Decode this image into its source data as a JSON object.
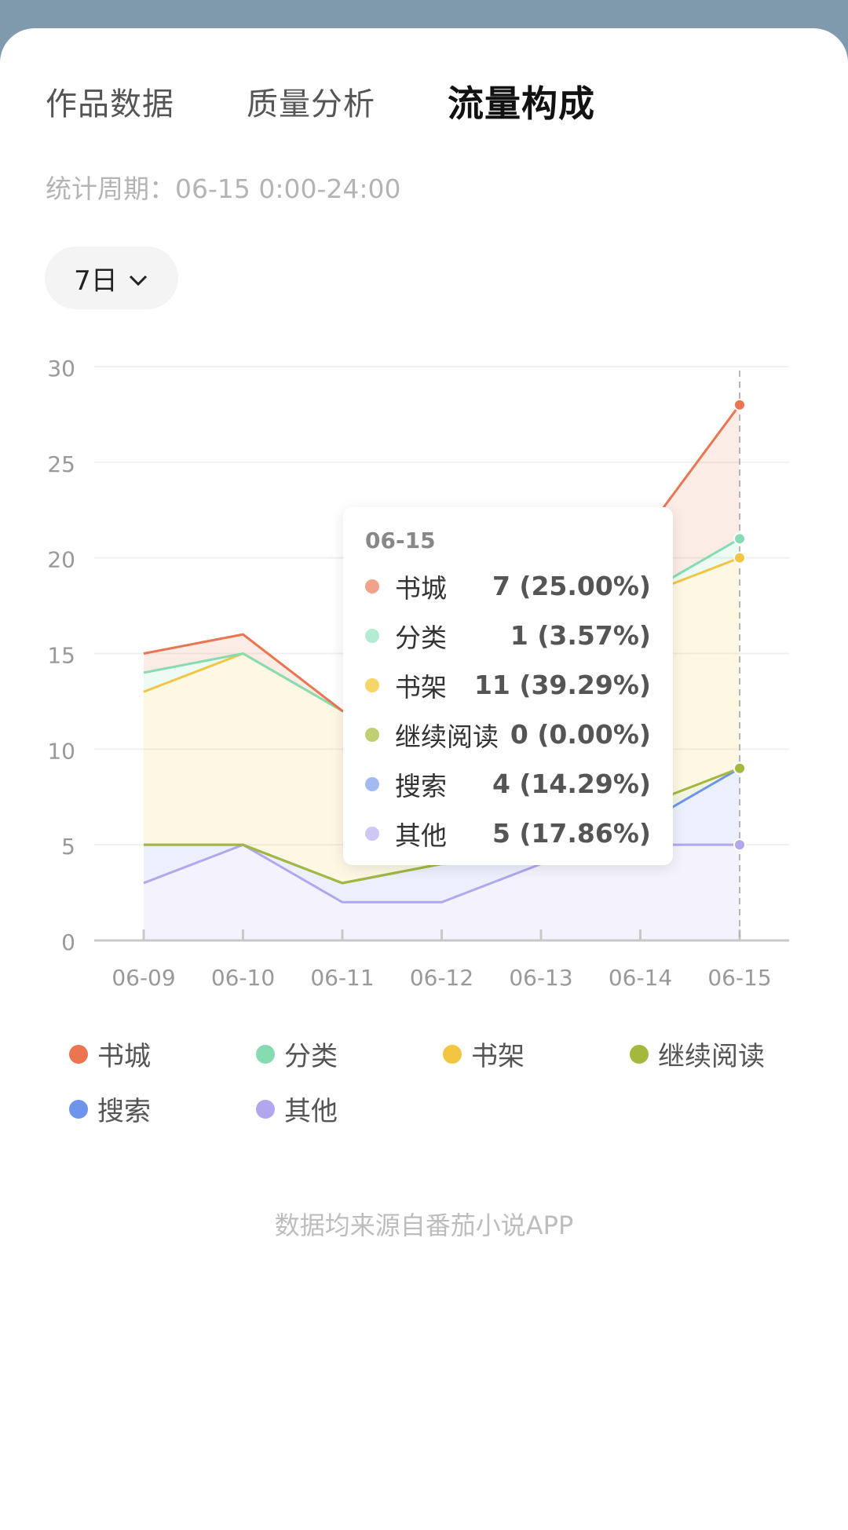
{
  "tabs": [
    {
      "label": "作品数据",
      "active": false
    },
    {
      "label": "质量分析",
      "active": false
    },
    {
      "label": "流量构成",
      "active": true
    }
  ],
  "period_text": "统计周期：06-15 0:00-24:00",
  "range_selector": {
    "label": "7日",
    "icon": "chevron-down-icon"
  },
  "chart_data": {
    "type": "area",
    "stacked": true,
    "categories": [
      "06-09",
      "06-10",
      "06-11",
      "06-12",
      "06-13",
      "06-14",
      "06-15"
    ],
    "ylim": [
      0,
      30
    ],
    "yticks": [
      0,
      5,
      10,
      15,
      20,
      25,
      30
    ],
    "grid": true,
    "series": [
      {
        "name": "其他",
        "color": "#b1a7ef",
        "values": [
          3,
          5,
          2,
          2,
          4,
          5,
          5
        ]
      },
      {
        "name": "搜索",
        "color": "#6f94ec",
        "values": [
          2,
          0,
          1,
          2,
          1,
          1,
          4
        ]
      },
      {
        "name": "继续阅读",
        "color": "#a3b83c",
        "values": [
          0,
          0,
          0,
          0,
          0,
          1,
          0
        ]
      },
      {
        "name": "书架",
        "color": "#f2c642",
        "values": [
          8,
          10,
          9,
          7,
          11,
          11,
          11
        ]
      },
      {
        "name": "分类",
        "color": "#86dcb0",
        "values": [
          1,
          0,
          0,
          0,
          0,
          0,
          1
        ]
      },
      {
        "name": "书城",
        "color": "#ea7550",
        "values": [
          1,
          1,
          0,
          0,
          0,
          3,
          7
        ]
      }
    ],
    "highlight_index": 6
  },
  "tooltip": {
    "date": "06-15",
    "rows": [
      {
        "name": "书城",
        "value": "7 (25.00%)",
        "color": "#f0a38a"
      },
      {
        "name": "分类",
        "value": "1 (3.57%)",
        "color": "#b3ecd2"
      },
      {
        "name": "书架",
        "value": "11 (39.29%)",
        "color": "#f5d666"
      },
      {
        "name": "继续阅读",
        "value": "0 (0.00%)",
        "color": "#c0d070"
      },
      {
        "name": "搜索",
        "value": "4 (14.29%)",
        "color": "#a2baf1"
      },
      {
        "name": "其他",
        "value": "5 (17.86%)",
        "color": "#cdc7f3"
      }
    ]
  },
  "legend": [
    {
      "name": "书城",
      "color": "#ea7550"
    },
    {
      "name": "分类",
      "color": "#86dcb0"
    },
    {
      "name": "书架",
      "color": "#f2c642"
    },
    {
      "name": "继续阅读",
      "color": "#a3b83c"
    },
    {
      "name": "搜索",
      "color": "#6f94ec"
    },
    {
      "name": "其他",
      "color": "#b1a7ef"
    }
  ],
  "footer_text": "数据均来源自番茄小说APP"
}
